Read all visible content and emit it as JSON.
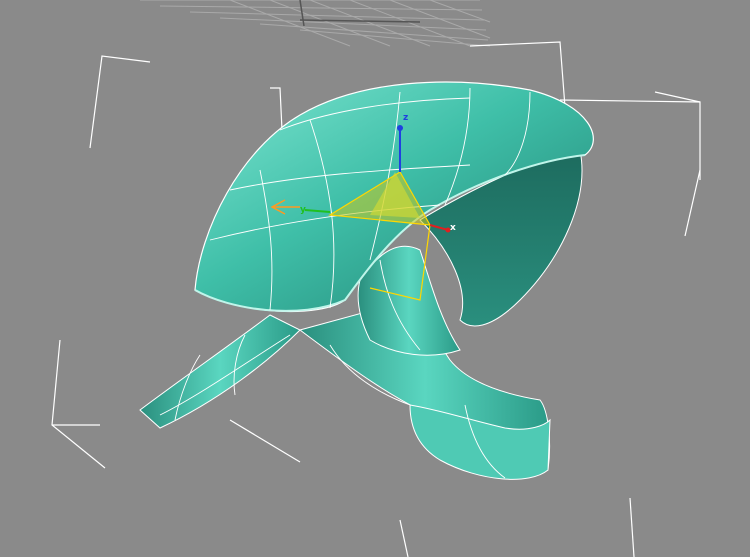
{
  "viewport": {
    "background_color": "#8a8a8a",
    "grid_color": "#a9a9a9",
    "bounding_box_color": "#ffffff",
    "model_color": "#3bbfa8",
    "wire_color": "#ffffff",
    "selection_color": "#ffd700"
  },
  "gizmo": {
    "x_label": "x",
    "y_label": "y",
    "z_label": "z",
    "x_color": "#e02020",
    "y_color": "#20c020",
    "z_color": "#2040e0",
    "plane_color": "#c8c820",
    "icon": "transform-gizmo-icon"
  },
  "model": {
    "icon": "chair-mesh-icon"
  }
}
